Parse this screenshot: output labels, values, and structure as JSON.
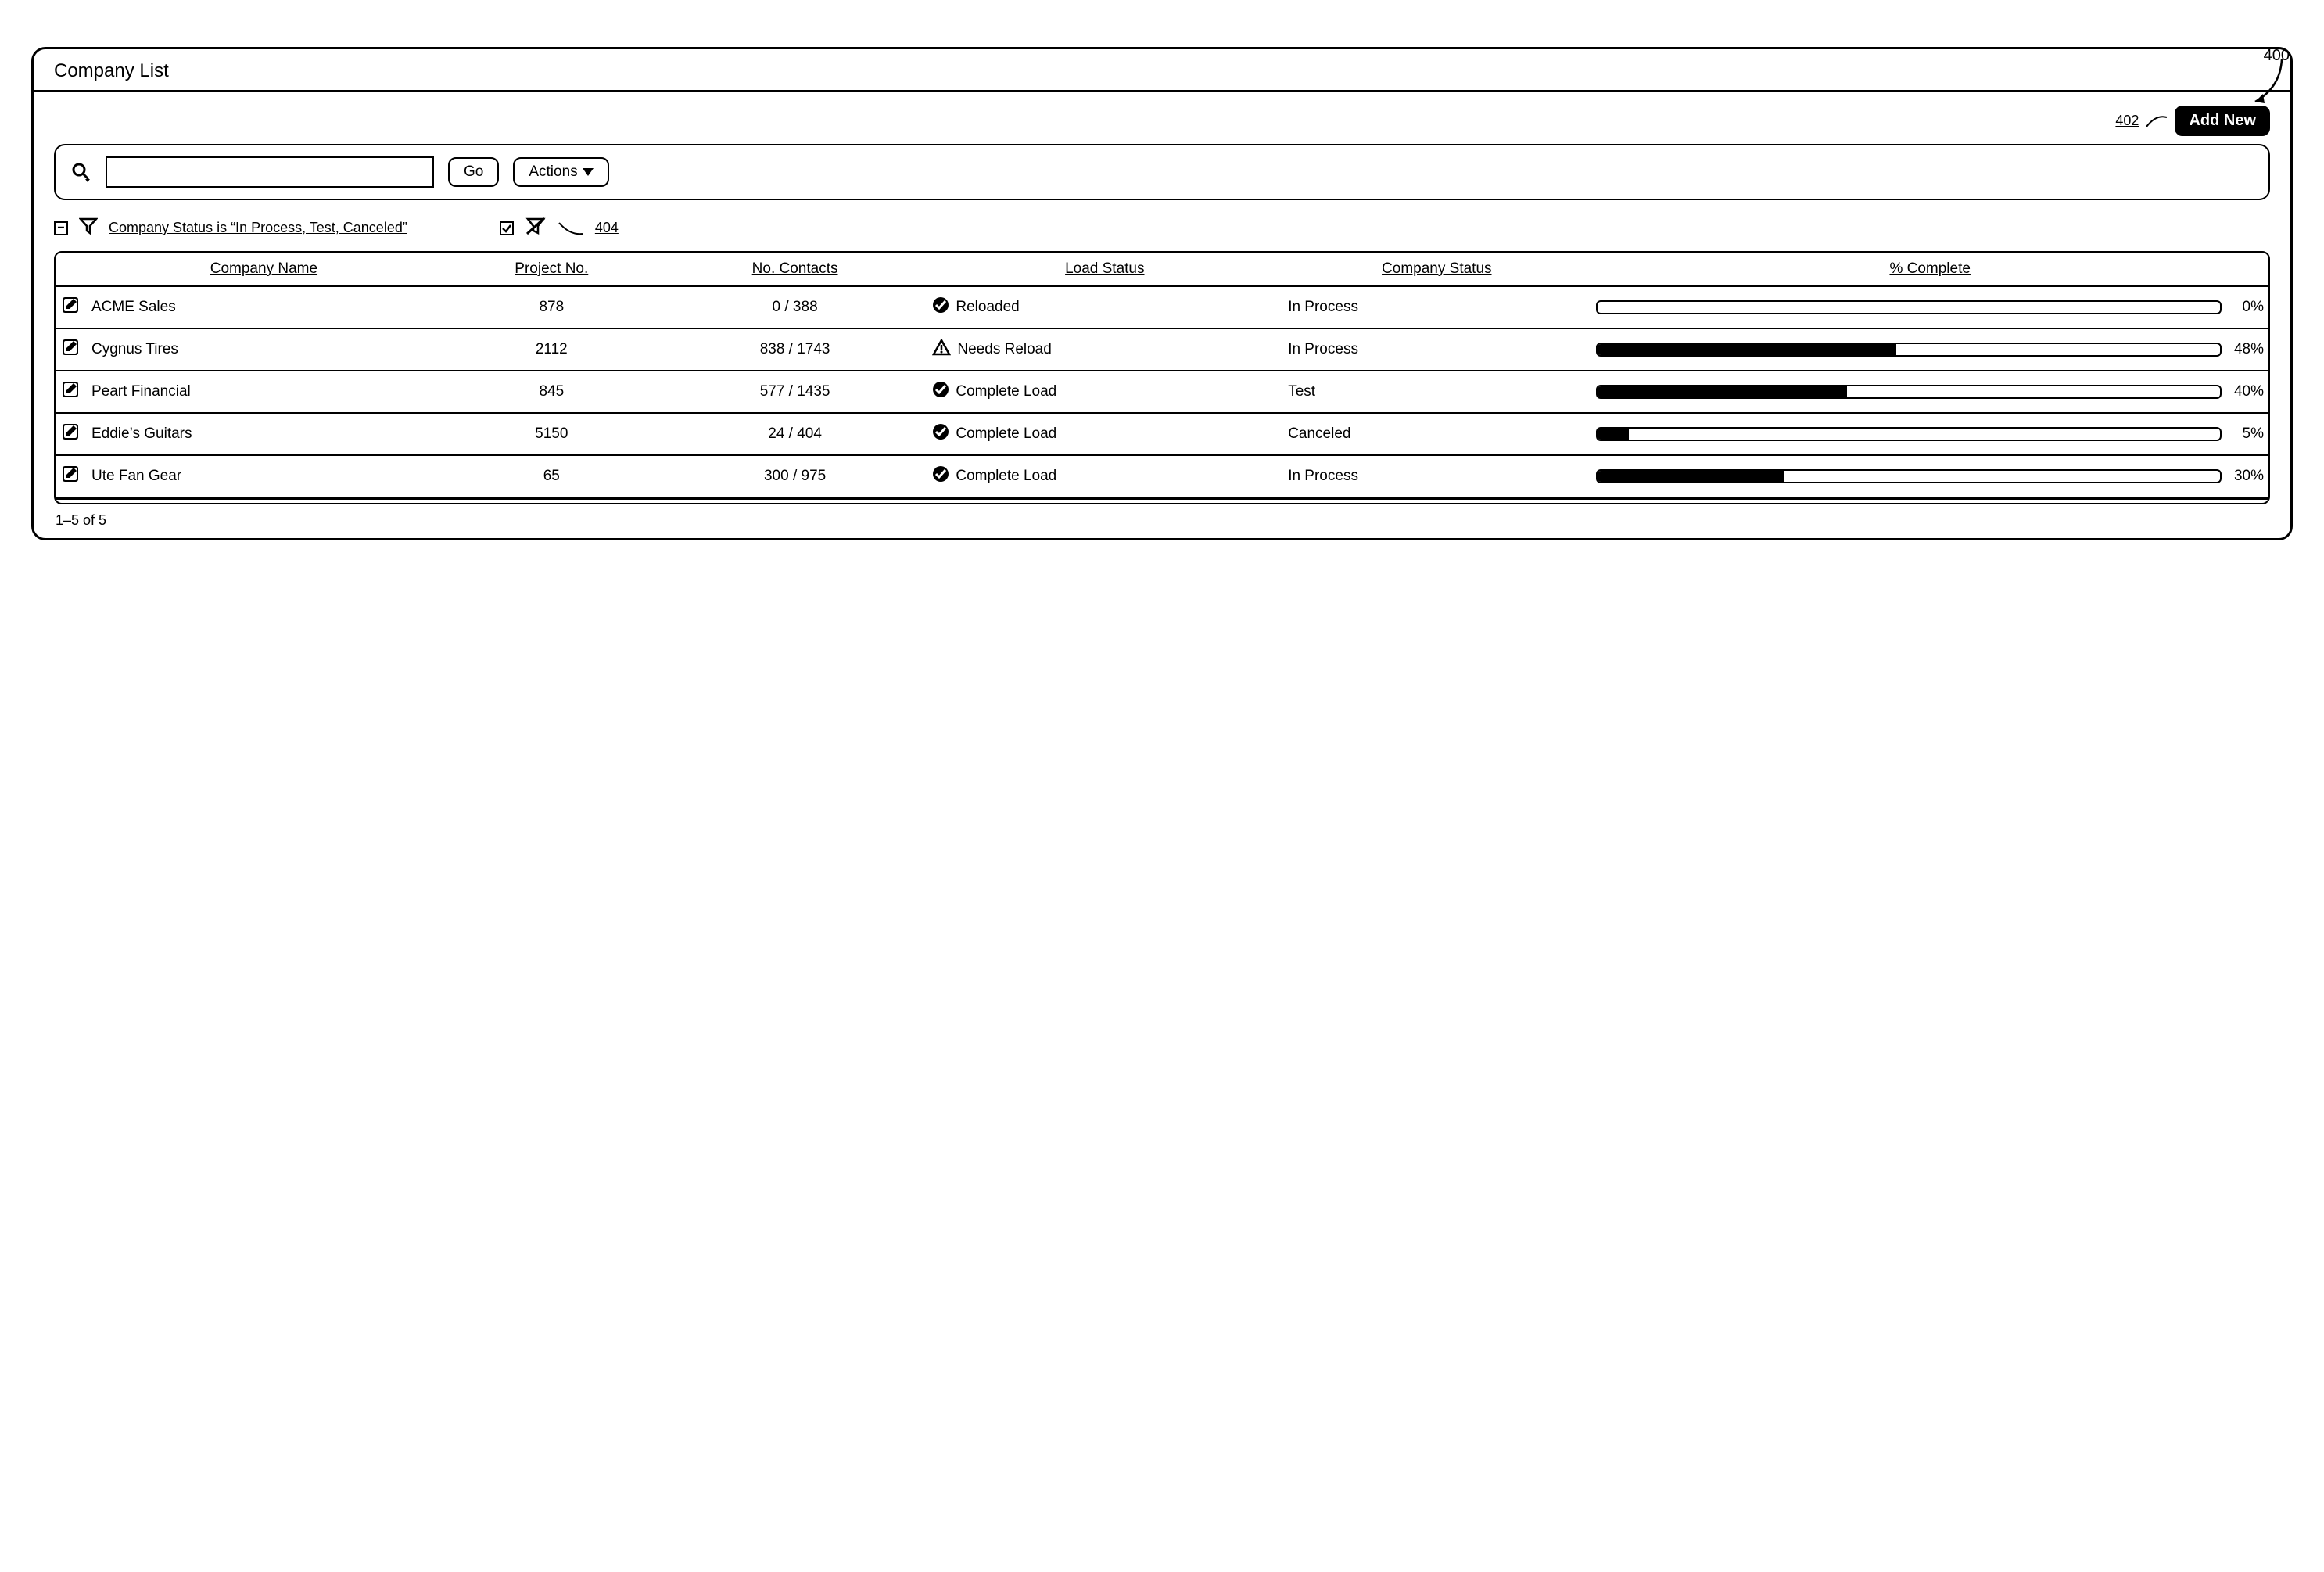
{
  "callouts": {
    "figure": "400",
    "add_new": "402",
    "filter_remove": "404"
  },
  "title": "Company List",
  "buttons": {
    "add_new": "Add New",
    "go": "Go",
    "actions": "Actions"
  },
  "search": {
    "value": ""
  },
  "filter": {
    "text": "Company Status is “In Process, Test, Canceled”",
    "enabled": true
  },
  "table": {
    "headers": {
      "company_name": "Company Name",
      "project_no": "Project No.",
      "no_contacts": "No. Contacts",
      "load_status": "Load Status",
      "company_status": "Company Status",
      "pct_complete": "% Complete"
    },
    "rows": [
      {
        "company_name": "ACME Sales",
        "project_no": "878",
        "no_contacts": "0 / 388",
        "load_status": "Reloaded",
        "load_icon": "check",
        "company_status": "In Process",
        "pct": 0
      },
      {
        "company_name": "Cygnus Tires",
        "project_no": "2112",
        "no_contacts": "838 / 1743",
        "load_status": "Needs Reload",
        "load_icon": "warning",
        "company_status": "In Process",
        "pct": 48
      },
      {
        "company_name": "Peart Financial",
        "project_no": "845",
        "no_contacts": "577 / 1435",
        "load_status": "Complete Load",
        "load_icon": "check",
        "company_status": "Test",
        "pct": 40
      },
      {
        "company_name": "Eddie’s Guitars",
        "project_no": "5150",
        "no_contacts": "24 / 404",
        "load_status": "Complete Load",
        "load_icon": "check",
        "company_status": "Canceled",
        "pct": 5
      },
      {
        "company_name": "Ute Fan Gear",
        "project_no": "65",
        "no_contacts": "300 / 975",
        "load_status": "Complete Load",
        "load_icon": "check",
        "company_status": "In Process",
        "pct": 30
      }
    ]
  },
  "pager": "1–5 of 5"
}
